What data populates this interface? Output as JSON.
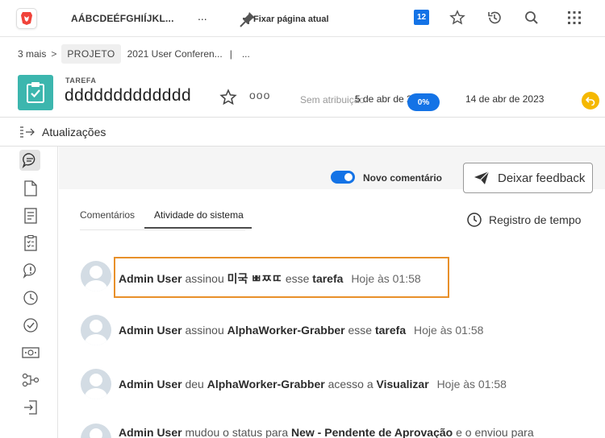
{
  "topbar": {
    "app_name": "AÁBCDEÉFGHIÍJKL...",
    "more": "...",
    "pin_label": "Fixar página atual",
    "notifications": "12"
  },
  "breadcrumb": {
    "more": "3 mais",
    "sep": ">",
    "project_badge": "PROJETO",
    "project_name": "2021 User Conferen...",
    "bar": "|",
    "dots": "..."
  },
  "header": {
    "type": "TAREFA",
    "title": "ddddddddddddd",
    "more": "ooo",
    "assignee": "Sem atribuição",
    "start_date": "5 de abr de 2",
    "progress": "0%",
    "end_date": "14 de abr de 2023"
  },
  "updates": {
    "label": "Atualizações"
  },
  "main": {
    "toggle_label": "Novo comentário",
    "feedback_label": "Deixar feedback",
    "tabs": [
      {
        "label": "Comentários"
      },
      {
        "label": "Atividade do sistema"
      }
    ],
    "time_log_label": "Registro de tempo"
  },
  "activity": [
    {
      "user": "Admin User",
      "verb": "assinou",
      "object": "미국 ㅃㅉㄸ",
      "mid": "esse",
      "target": "tarefa",
      "time": "Hoje às 01:58"
    },
    {
      "user": "Admin User",
      "verb": "assinou",
      "object": "AlphaWorker-Grabber",
      "mid": "esse",
      "target": "tarefa",
      "time": "Hoje às 01:58"
    },
    {
      "user": "Admin User",
      "verb": "deu",
      "object": "AlphaWorker-Grabber",
      "mid": "acesso a",
      "target": "Visualizar",
      "time": "Hoje às 01:58"
    },
    {
      "user": "Admin User",
      "verb": "mudou o status para",
      "object": "New - Pendente de Aprovação",
      "mid": "e o enviou para",
      "target": "",
      "time": ""
    }
  ],
  "colors": {
    "accent": "#1473e6",
    "task_icon": "#3cb6ae",
    "status": "#f5b800",
    "highlight": "#e8902a"
  }
}
